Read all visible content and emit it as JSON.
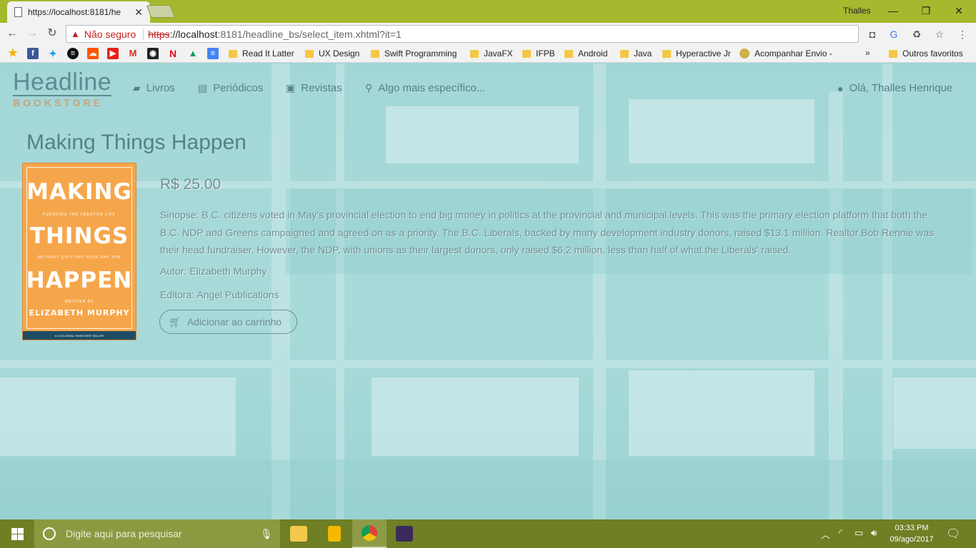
{
  "browser": {
    "tab_title": "https://localhost:8181/he",
    "tab_close": "✕",
    "window_user": "Thalles",
    "url": {
      "insecure_label": "Não seguro",
      "scheme": "https",
      "host": "://localhost",
      "rest": ":8181/headline_bs/select_item.xhtml?it=1"
    },
    "bookmarks": [
      "Read It Latter",
      "UX Design",
      "Swift Programming",
      "JavaFX",
      "IFPB",
      "Android",
      "Java",
      "Hyperactive Jr",
      "Acompanhar Envio -"
    ],
    "more": "»",
    "other_bookmarks": "Outros favoritos"
  },
  "site": {
    "logo_main": "Headline",
    "logo_sub": "BOOKSTORE",
    "nav": {
      "books": "Livros",
      "periodicals": "Periódicos",
      "magazines": "Revistas",
      "search": "Algo mais específico..."
    },
    "user_greeting": "Olá, Thalles Henrique"
  },
  "book": {
    "title": "Making Things Happen",
    "price": "R$ 25.00",
    "synopsis": "Sinopse: B.C. citizens voted in May's provincial election to end big money in politics at the provincial and municipal levels. This was the primary election platform that both the B.C. NDP and Greens campaigned and agreed on as a priority. The B.C. Liberals, backed by many development industry donors, raised $13.1 million. Realtor Bob Rennie was their head fundraiser. However, the NDP, with unions as their largest donors, only raised $6.2 million, less than half of what the Liberals' raised.",
    "author": "Autor: Elizabeth Murphy",
    "publisher": "Editora: Angel Publications",
    "add_to_cart": "Adicionar ao carrinho",
    "cover": {
      "word1": "MAKING",
      "tagline": "PURSUING THE CREATIVE LIFE",
      "word2": "THINGS",
      "tagline2": "WITHOUT QUITTING YOUR DAY JOB",
      "word3": "HAPPEN",
      "written_by": "WRITTEN BY",
      "author": "ELIZABETH MURPHY",
      "band": "#1 COLOSSAL TIMES BEST SELLER"
    }
  },
  "taskbar": {
    "search_placeholder": "Digite aqui para pesquisar",
    "time": "03:33 PM",
    "date": "09/ago/2017"
  },
  "colors": {
    "page_bg": "#a3d7d7",
    "taskbar": "#6f7f24",
    "titlebar": "#a6b82e",
    "cover": "#f6a64a",
    "insecure": "#c5221f"
  }
}
